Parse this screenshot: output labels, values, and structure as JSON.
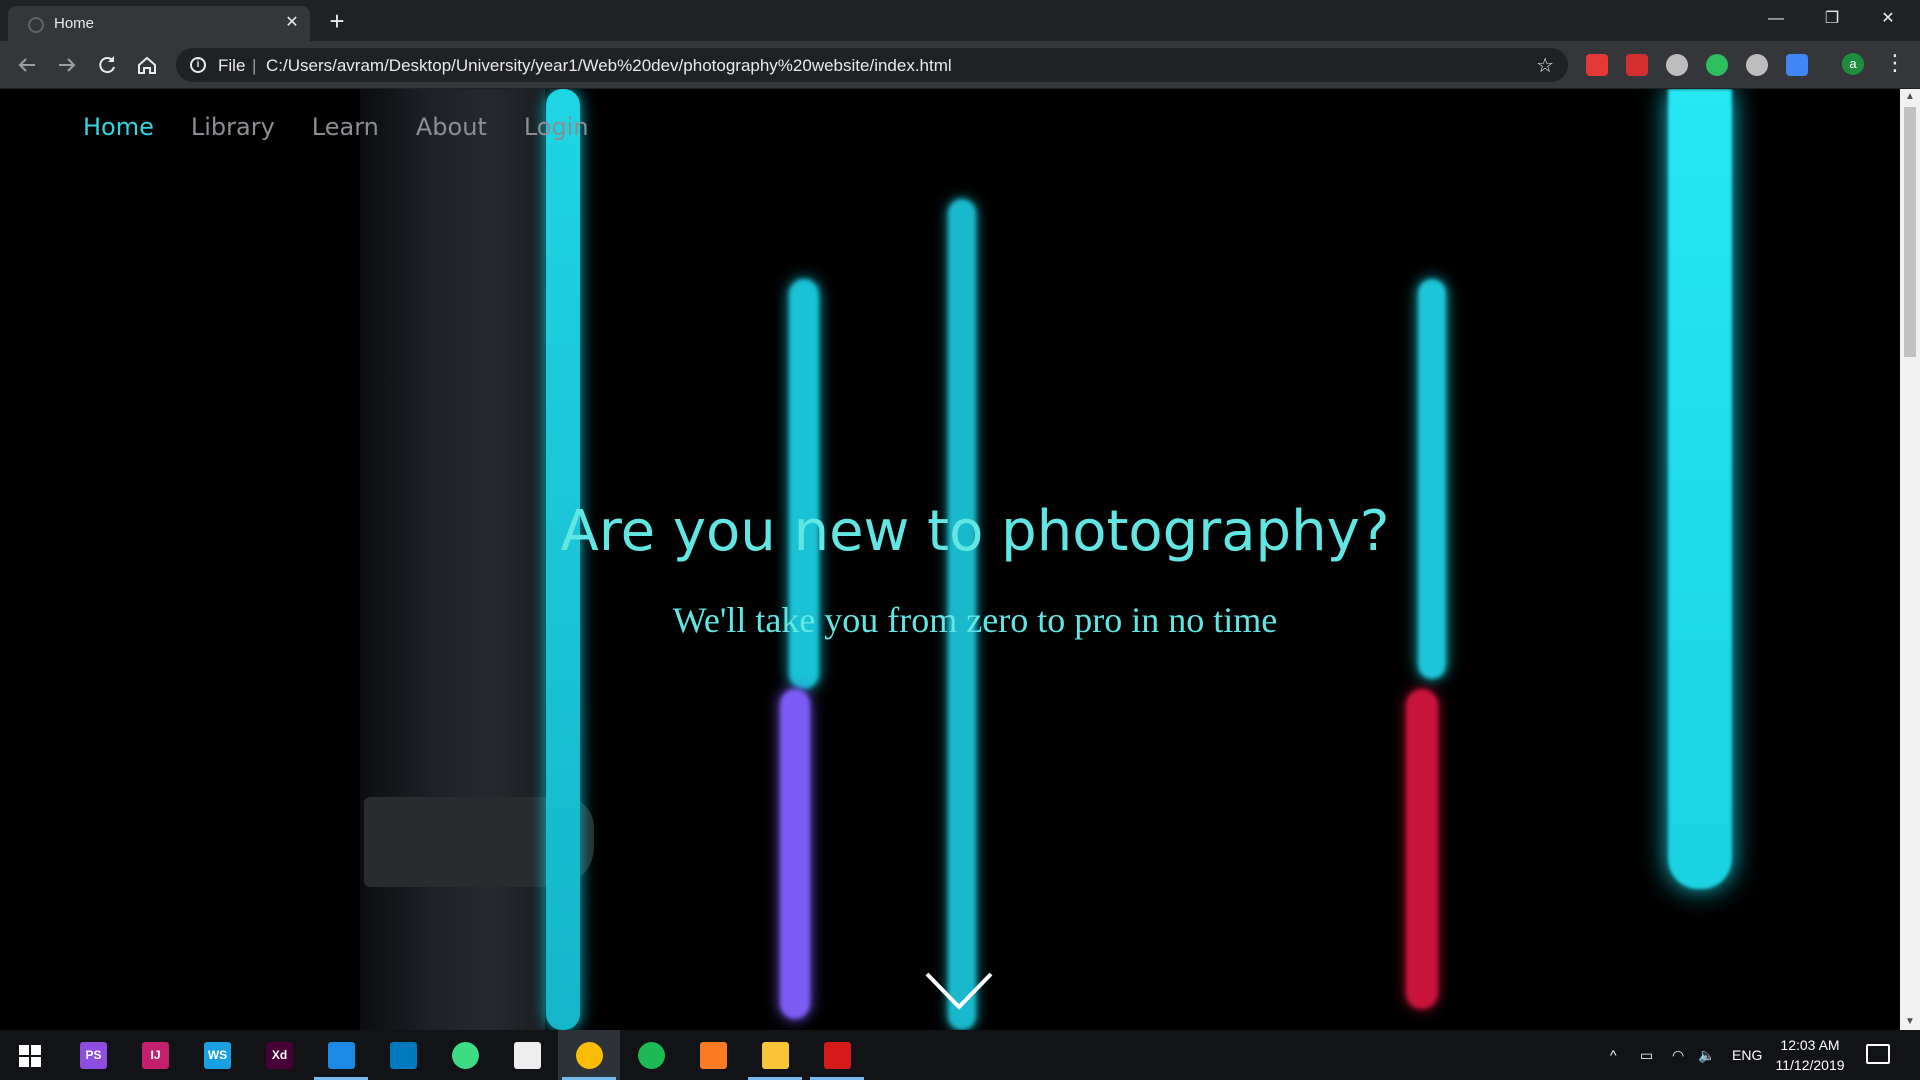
{
  "browser": {
    "tab_title": "Home",
    "tab_close_glyph": "✕",
    "new_tab_glyph": "+",
    "scheme_label": "File",
    "scheme_separator": "|",
    "url": "C:/Users/avram/Desktop/University/year1/Web%20dev/photography%20website/index.html",
    "window_controls": {
      "minimize": "—",
      "restore": "❐",
      "close": "✕"
    },
    "nav_icons": [
      "back-icon",
      "forward-icon",
      "reload-icon",
      "home-icon"
    ],
    "profile_initial": "a",
    "extensions": [
      {
        "name": "adblock-extension-icon",
        "color": "#e53935"
      },
      {
        "name": "lastpass-extension-icon",
        "color": "#d32f2f"
      },
      {
        "name": "grey-circle-extension-icon",
        "color": "#bdbdbd"
      },
      {
        "name": "evernote-extension-icon",
        "color": "#2dbe60"
      },
      {
        "name": "gear-extension-icon",
        "color": "#bdbdbd"
      },
      {
        "name": "google-translate-extension-icon",
        "color": "#4285f4"
      }
    ]
  },
  "site": {
    "nav": [
      {
        "label": "Home",
        "current": true
      },
      {
        "label": "Library",
        "current": false
      },
      {
        "label": "Learn",
        "current": false
      },
      {
        "label": "About",
        "current": false
      },
      {
        "label": "Login",
        "current": false
      }
    ],
    "hero_title": "Are you new to photography?",
    "hero_subtitle": "We'll take you from zero to pro in no time",
    "scroll_indicator": "chevron-down-icon",
    "accent_color": "#62e6e3"
  },
  "taskbar": {
    "apps": [
      {
        "name": "phpstorm-app",
        "label": "PS",
        "color": "#8d4de0",
        "running": false
      },
      {
        "name": "intellij-app",
        "label": "IJ",
        "color": "#c21f6d",
        "running": false
      },
      {
        "name": "webstorm-app",
        "label": "WS",
        "color": "#1a9fe0",
        "running": false
      },
      {
        "name": "adobe-xd-app",
        "label": "Xd",
        "color": "#470137",
        "running": false
      },
      {
        "name": "vscode-app",
        "label": "",
        "color": "#1e88e5",
        "running": true
      },
      {
        "name": "trello-app",
        "label": "",
        "color": "#0079bf",
        "running": false
      },
      {
        "name": "android-studio-app",
        "label": "",
        "color": "#3ddc84",
        "running": false
      },
      {
        "name": "unity-app",
        "label": "",
        "color": "#eeeeee",
        "running": false
      },
      {
        "name": "chrome-app",
        "label": "",
        "color": "#fbbc05",
        "running": true,
        "focused": true
      },
      {
        "name": "spotify-app",
        "label": "",
        "color": "#1db954",
        "running": false
      },
      {
        "name": "xampp-app",
        "label": "",
        "color": "#fb7a24",
        "running": false
      },
      {
        "name": "file-explorer-app",
        "label": "",
        "color": "#f8c43a",
        "running": true
      },
      {
        "name": "acrobat-app",
        "label": "",
        "color": "#d61a1a",
        "running": true
      }
    ],
    "language": "ENG",
    "time": "12:03 AM",
    "date": "11/12/2019"
  }
}
